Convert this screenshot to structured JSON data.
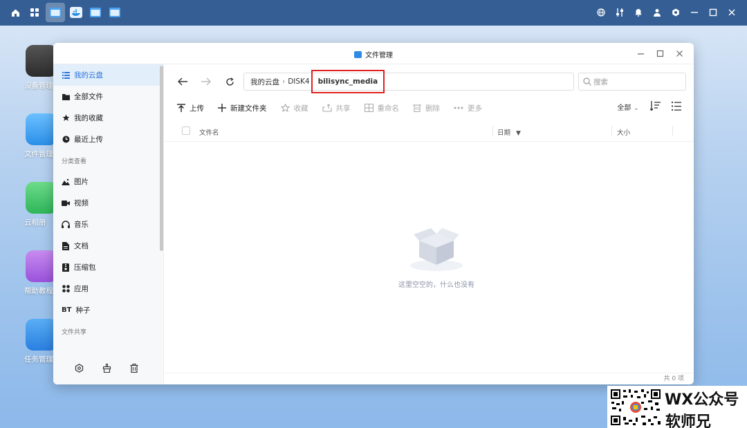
{
  "desktop": {
    "icons": [
      {
        "label": "设备管理"
      },
      {
        "label": "文件管理"
      },
      {
        "label": "云相册"
      },
      {
        "label": "帮助教程"
      },
      {
        "label": "任务管理"
      }
    ]
  },
  "window": {
    "title": "文件管理"
  },
  "sidebar": {
    "items": [
      {
        "label": "我的云盘",
        "icon": "list-icon"
      },
      {
        "label": "全部文件",
        "icon": "folder-icon"
      },
      {
        "label": "我的收藏",
        "icon": "star-icon"
      },
      {
        "label": "最近上传",
        "icon": "clock-icon"
      }
    ],
    "section_category": "分类查看",
    "categories": [
      {
        "label": "图片",
        "icon": "image-icon"
      },
      {
        "label": "视频",
        "icon": "video-icon"
      },
      {
        "label": "音乐",
        "icon": "headphones-icon"
      },
      {
        "label": "文档",
        "icon": "document-icon"
      },
      {
        "label": "压缩包",
        "icon": "archive-icon"
      },
      {
        "label": "应用",
        "icon": "apps-icon"
      },
      {
        "label": "种子",
        "icon_text": "BT"
      }
    ],
    "section_share": "文件共享"
  },
  "breadcrumb": {
    "items": [
      "我的云盘",
      "DISK4"
    ],
    "current": "bilisync_media"
  },
  "search": {
    "placeholder": "搜索"
  },
  "toolbar": {
    "upload": "上传",
    "new_folder": "新建文件夹",
    "favorite": "收藏",
    "share": "共享",
    "rename": "重命名",
    "delete": "删除",
    "more": "更多",
    "filter": "全部"
  },
  "table": {
    "col_name": "文件名",
    "col_date": "日期",
    "col_size": "大小"
  },
  "empty_text": "这里空空的，什么也没有",
  "footer_count": "共 0 项",
  "watermark": {
    "line1": "WX公众号",
    "line2": "软师兄"
  }
}
